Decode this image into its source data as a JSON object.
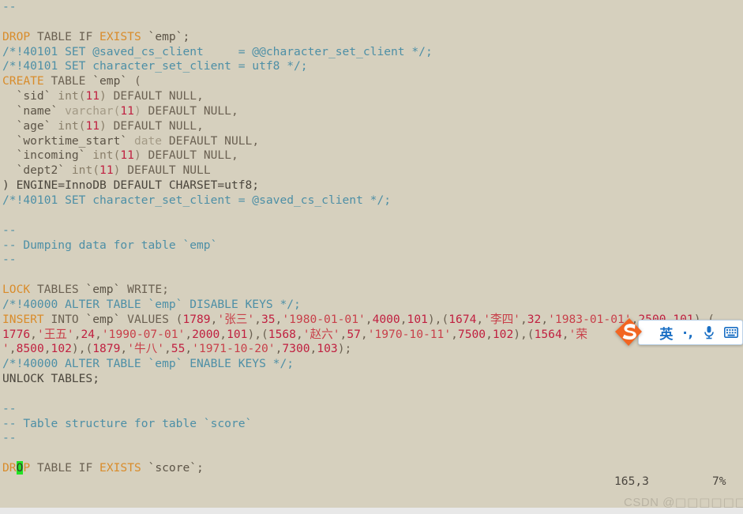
{
  "app": {
    "name": "vim",
    "background_color": "#d6d0be",
    "cursor_color": "#23e223"
  },
  "editor": {
    "lines": [
      {
        "n": 1,
        "segments": [
          {
            "c": "t-comment",
            "t": "--"
          }
        ]
      },
      {
        "n": 2,
        "segments": [
          {
            "c": "t-plain",
            "t": ""
          }
        ]
      },
      {
        "n": 3,
        "segments": [
          {
            "c": "t-keyword",
            "t": "DROP"
          },
          {
            "c": "t-plain",
            "t": " TABLE IF "
          },
          {
            "c": "t-keyword",
            "t": "EXISTS"
          },
          {
            "c": "t-ident",
            "t": " `emp`;"
          }
        ]
      },
      {
        "n": 4,
        "segments": [
          {
            "c": "t-comment",
            "t": "/*!40101 SET @saved_cs_client     = @@character_set_client */;"
          }
        ]
      },
      {
        "n": 5,
        "segments": [
          {
            "c": "t-comment",
            "t": "/*!40101 SET character_set_client = utf8 */;"
          }
        ]
      },
      {
        "n": 6,
        "segments": [
          {
            "c": "t-keyword",
            "t": "CREATE"
          },
          {
            "c": "t-plain",
            "t": " TABLE "
          },
          {
            "c": "t-ident",
            "t": "`emp`"
          },
          {
            "c": "t-plain",
            "t": " ("
          }
        ]
      },
      {
        "n": 7,
        "segments": [
          {
            "c": "t-ident",
            "t": "  `sid` "
          },
          {
            "c": "t-typei",
            "t": "int("
          },
          {
            "c": "t-number",
            "t": "11"
          },
          {
            "c": "t-typei",
            "t": ")"
          },
          {
            "c": "t-plain",
            "t": " DEFAULT NULL,"
          }
        ]
      },
      {
        "n": 8,
        "segments": [
          {
            "c": "t-ident",
            "t": "  `name` "
          },
          {
            "c": "t-type",
            "t": "varchar("
          },
          {
            "c": "t-number",
            "t": "11"
          },
          {
            "c": "t-type",
            "t": ")"
          },
          {
            "c": "t-plain",
            "t": " DEFAULT NULL,"
          }
        ]
      },
      {
        "n": 9,
        "segments": [
          {
            "c": "t-ident",
            "t": "  `age` "
          },
          {
            "c": "t-typei",
            "t": "int("
          },
          {
            "c": "t-number",
            "t": "11"
          },
          {
            "c": "t-typei",
            "t": ")"
          },
          {
            "c": "t-plain",
            "t": " DEFAULT NULL,"
          }
        ]
      },
      {
        "n": 10,
        "segments": [
          {
            "c": "t-ident",
            "t": "  `worktime_start` "
          },
          {
            "c": "t-type",
            "t": "date"
          },
          {
            "c": "t-plain",
            "t": " DEFAULT NULL,"
          }
        ]
      },
      {
        "n": 11,
        "segments": [
          {
            "c": "t-ident",
            "t": "  `incoming` "
          },
          {
            "c": "t-typei",
            "t": "int("
          },
          {
            "c": "t-number",
            "t": "11"
          },
          {
            "c": "t-typei",
            "t": ")"
          },
          {
            "c": "t-plain",
            "t": " DEFAULT NULL,"
          }
        ]
      },
      {
        "n": 12,
        "segments": [
          {
            "c": "t-ident",
            "t": "  `dept2` "
          },
          {
            "c": "t-typei",
            "t": "int("
          },
          {
            "c": "t-number",
            "t": "11"
          },
          {
            "c": "t-typei",
            "t": ")"
          },
          {
            "c": "t-plain",
            "t": " DEFAULT NULL"
          }
        ]
      },
      {
        "n": 13,
        "segments": [
          {
            "c": "t-dark",
            "t": ") ENGINE=InnoDB DEFAULT CHARSET=utf8;"
          }
        ]
      },
      {
        "n": 14,
        "segments": [
          {
            "c": "t-comment",
            "t": "/*!40101 SET character_set_client = @saved_cs_client */;"
          }
        ]
      },
      {
        "n": 15,
        "segments": [
          {
            "c": "t-plain",
            "t": ""
          }
        ]
      },
      {
        "n": 16,
        "segments": [
          {
            "c": "t-comment",
            "t": "--"
          }
        ]
      },
      {
        "n": 17,
        "segments": [
          {
            "c": "t-comment",
            "t": "-- Dumping data for table `emp`"
          }
        ]
      },
      {
        "n": 18,
        "segments": [
          {
            "c": "t-comment",
            "t": "--"
          }
        ]
      },
      {
        "n": 19,
        "segments": [
          {
            "c": "t-plain",
            "t": ""
          }
        ]
      },
      {
        "n": 20,
        "segments": [
          {
            "c": "t-keyword",
            "t": "LOCK"
          },
          {
            "c": "t-plain",
            "t": " TABLES "
          },
          {
            "c": "t-ident",
            "t": "`emp`"
          },
          {
            "c": "t-plain",
            "t": " WRITE;"
          }
        ]
      },
      {
        "n": 21,
        "segments": [
          {
            "c": "t-comment",
            "t": "/*!40000 ALTER TABLE `emp` DISABLE KEYS */;"
          }
        ]
      },
      {
        "n": 22,
        "segments": [
          {
            "c": "t-keyword",
            "t": "INSERT"
          },
          {
            "c": "t-plain",
            "t": " INTO "
          },
          {
            "c": "t-ident",
            "t": "`emp`"
          },
          {
            "c": "t-plain",
            "t": " VALUES ("
          },
          {
            "c": "t-number",
            "t": "1789"
          },
          {
            "c": "t-plain",
            "t": ","
          },
          {
            "c": "t-string",
            "t": "'张三'"
          },
          {
            "c": "t-plain",
            "t": ","
          },
          {
            "c": "t-number",
            "t": "35"
          },
          {
            "c": "t-plain",
            "t": ","
          },
          {
            "c": "t-string",
            "t": "'1980-01-01'"
          },
          {
            "c": "t-plain",
            "t": ","
          },
          {
            "c": "t-number",
            "t": "4000"
          },
          {
            "c": "t-plain",
            "t": ","
          },
          {
            "c": "t-number",
            "t": "101"
          },
          {
            "c": "t-plain",
            "t": "),("
          },
          {
            "c": "t-number",
            "t": "1674"
          },
          {
            "c": "t-plain",
            "t": ","
          },
          {
            "c": "t-string",
            "t": "'李四'"
          },
          {
            "c": "t-plain",
            "t": ","
          },
          {
            "c": "t-number",
            "t": "32"
          },
          {
            "c": "t-plain",
            "t": ","
          },
          {
            "c": "t-string",
            "t": "'1983-01-01'"
          },
          {
            "c": "t-plain",
            "t": ","
          },
          {
            "c": "t-number",
            "t": "2500"
          },
          {
            "c": "t-plain",
            "t": ","
          },
          {
            "c": "t-number",
            "t": "101"
          },
          {
            "c": "t-plain",
            "t": "),("
          }
        ]
      },
      {
        "n": 23,
        "segments": [
          {
            "c": "t-number",
            "t": "1776"
          },
          {
            "c": "t-plain",
            "t": ","
          },
          {
            "c": "t-string",
            "t": "'王五'"
          },
          {
            "c": "t-plain",
            "t": ","
          },
          {
            "c": "t-number",
            "t": "24"
          },
          {
            "c": "t-plain",
            "t": ","
          },
          {
            "c": "t-string",
            "t": "'1990-07-01'"
          },
          {
            "c": "t-plain",
            "t": ","
          },
          {
            "c": "t-number",
            "t": "2000"
          },
          {
            "c": "t-plain",
            "t": ","
          },
          {
            "c": "t-number",
            "t": "101"
          },
          {
            "c": "t-plain",
            "t": "),("
          },
          {
            "c": "t-number",
            "t": "1568"
          },
          {
            "c": "t-plain",
            "t": ","
          },
          {
            "c": "t-string",
            "t": "'赵六'"
          },
          {
            "c": "t-plain",
            "t": ","
          },
          {
            "c": "t-number",
            "t": "57"
          },
          {
            "c": "t-plain",
            "t": ","
          },
          {
            "c": "t-string",
            "t": "'1970-10-11'"
          },
          {
            "c": "t-plain",
            "t": ","
          },
          {
            "c": "t-number",
            "t": "7500"
          },
          {
            "c": "t-plain",
            "t": ","
          },
          {
            "c": "t-number",
            "t": "102"
          },
          {
            "c": "t-plain",
            "t": "),("
          },
          {
            "c": "t-number",
            "t": "1564"
          },
          {
            "c": "t-plain",
            "t": ","
          },
          {
            "c": "t-string",
            "t": "'荣"
          }
        ]
      },
      {
        "n": 24,
        "segments": [
          {
            "c": "t-string",
            "t": "'"
          },
          {
            "c": "t-plain",
            "t": ","
          },
          {
            "c": "t-number",
            "t": "8500"
          },
          {
            "c": "t-plain",
            "t": ","
          },
          {
            "c": "t-number",
            "t": "102"
          },
          {
            "c": "t-plain",
            "t": "),("
          },
          {
            "c": "t-number",
            "t": "1879"
          },
          {
            "c": "t-plain",
            "t": ","
          },
          {
            "c": "t-string",
            "t": "'牛八'"
          },
          {
            "c": "t-plain",
            "t": ","
          },
          {
            "c": "t-number",
            "t": "55"
          },
          {
            "c": "t-plain",
            "t": ","
          },
          {
            "c": "t-string",
            "t": "'1971-10-20'"
          },
          {
            "c": "t-plain",
            "t": ","
          },
          {
            "c": "t-number",
            "t": "7300"
          },
          {
            "c": "t-plain",
            "t": ","
          },
          {
            "c": "t-number",
            "t": "103"
          },
          {
            "c": "t-plain",
            "t": ");"
          }
        ]
      },
      {
        "n": 25,
        "segments": [
          {
            "c": "t-comment",
            "t": "/*!40000 ALTER TABLE `emp` ENABLE KEYS */;"
          }
        ]
      },
      {
        "n": 26,
        "segments": [
          {
            "c": "t-dark",
            "t": "UNLOCK TABLES;"
          }
        ]
      },
      {
        "n": 27,
        "segments": [
          {
            "c": "t-plain",
            "t": ""
          }
        ]
      },
      {
        "n": 28,
        "segments": [
          {
            "c": "t-comment",
            "t": "--"
          }
        ]
      },
      {
        "n": 29,
        "segments": [
          {
            "c": "t-comment",
            "t": "-- Table structure for table `score`"
          }
        ]
      },
      {
        "n": 30,
        "segments": [
          {
            "c": "t-comment",
            "t": "--"
          }
        ]
      },
      {
        "n": 31,
        "segments": [
          {
            "c": "t-plain",
            "t": ""
          }
        ]
      },
      {
        "n": 32,
        "segments": [
          {
            "c": "t-keyword",
            "t": "DR"
          },
          {
            "c": "cursor-block",
            "t": "O"
          },
          {
            "c": "t-keyword",
            "t": "P"
          },
          {
            "c": "t-plain",
            "t": " TABLE IF "
          },
          {
            "c": "t-keyword",
            "t": "EXISTS"
          },
          {
            "c": "t-ident",
            "t": " `score`;"
          }
        ]
      }
    ]
  },
  "status": {
    "ruler_position": "165,3",
    "ruler_percent": "7%"
  },
  "watermark": {
    "prefix": "CSDN @",
    "username": "□□□□□□"
  },
  "ime": {
    "logo_letter": "S",
    "mode_label": "英",
    "punctuation_label": "·,",
    "mic_icon": "microphone-icon",
    "keyboard_icon": "keyboard-icon"
  }
}
